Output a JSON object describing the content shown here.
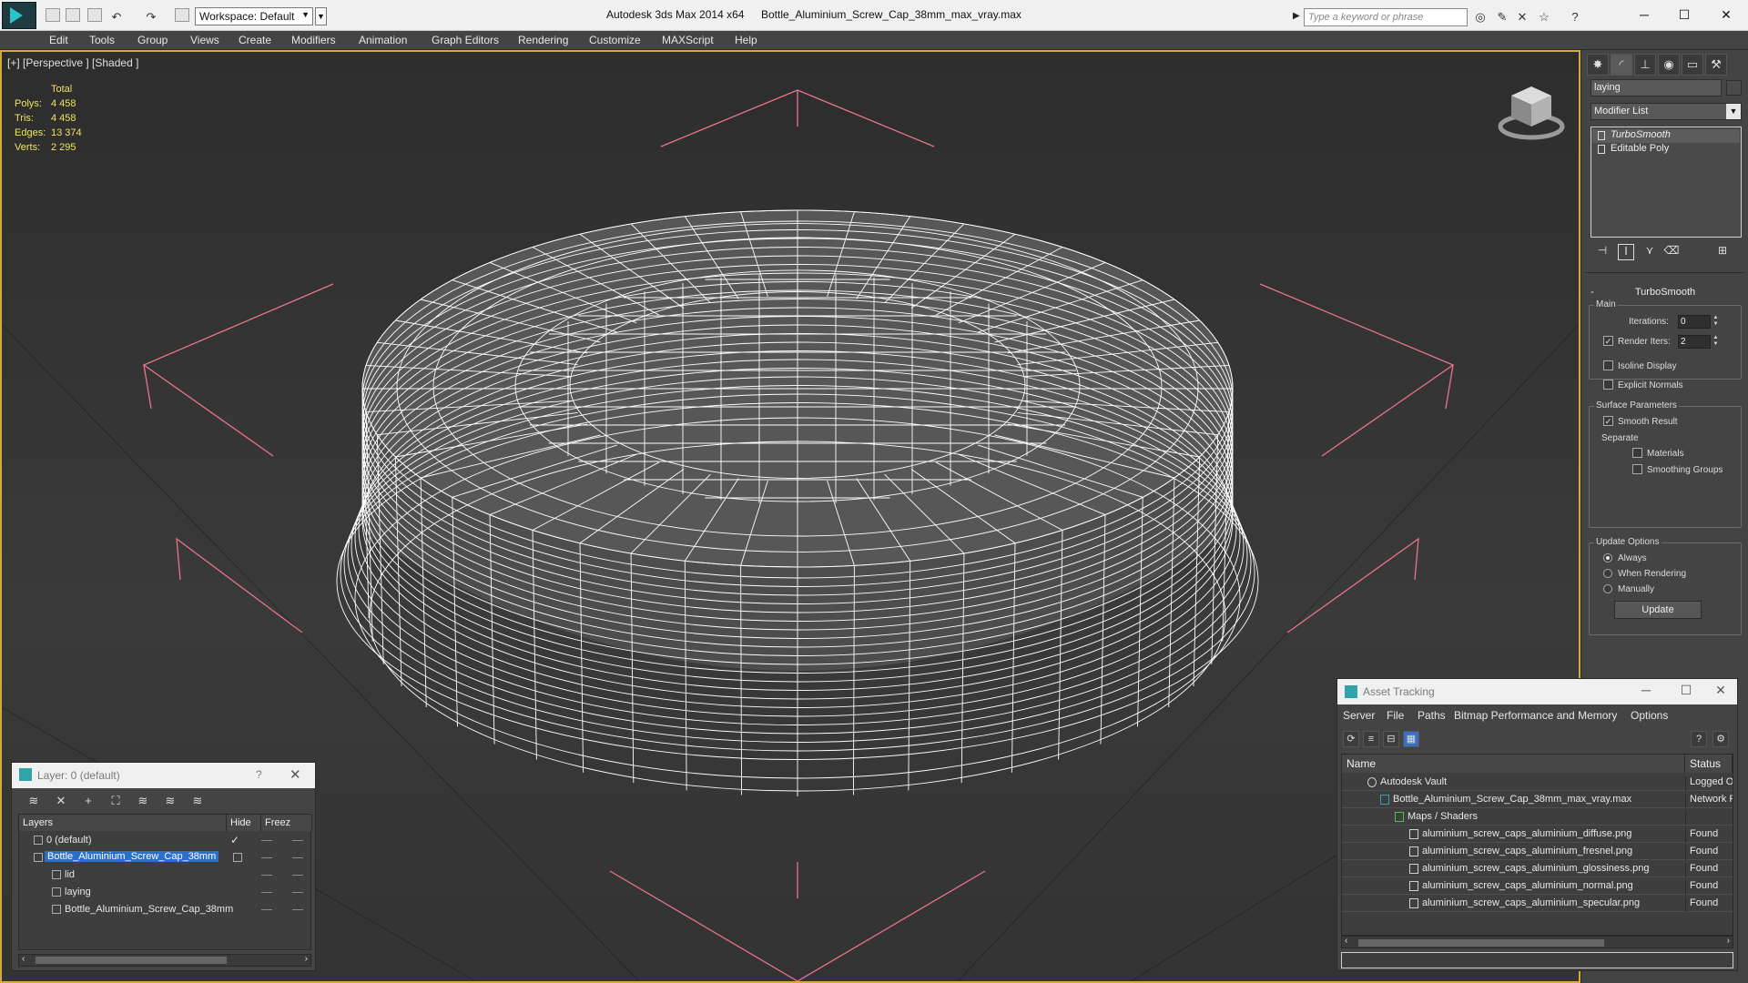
{
  "titlebar": {
    "workspace": "Workspace: Default",
    "app_title": "Autodesk 3ds Max  2014 x64",
    "file_title": "Bottle_Aluminium_Screw_Cap_38mm_max_vray.max",
    "search_placeholder": "Type a keyword or phrase"
  },
  "menu": [
    "Edit",
    "Tools",
    "Group",
    "Views",
    "Create",
    "Modifiers",
    "Animation",
    "Graph Editors",
    "Rendering",
    "Customize",
    "MAXScript",
    "Help"
  ],
  "viewport": {
    "label": "[+] [Perspective ] [Shaded ]",
    "stats_header": "Total",
    "stats": [
      {
        "key": "Polys:",
        "value": "4 458"
      },
      {
        "key": "Tris:",
        "value": "4 458"
      },
      {
        "key": "Edges:",
        "value": "13 374"
      },
      {
        "key": "Verts:",
        "value": "2 295"
      }
    ]
  },
  "command_panel": {
    "object_name": "laying",
    "modifier_list": "Modifier List",
    "stack": [
      {
        "label": "TurboSmooth",
        "selected": true
      },
      {
        "label": "Editable Poly",
        "selected": false
      }
    ],
    "rollout_title": "TurboSmooth",
    "main_label": "Main",
    "iterations_label": "Iterations:",
    "iterations_value": "0",
    "render_iters_label": "Render Iters:",
    "render_iters_value": "2",
    "isoline_label": "Isoline Display",
    "explicit_normals_label": "Explicit Normals",
    "surface_params_label": "Surface Parameters",
    "smooth_result_label": "Smooth Result",
    "separate_label": "Separate",
    "materials_label": "Materials",
    "smoothing_groups_label": "Smoothing Groups",
    "update_options_label": "Update Options",
    "always_label": "Always",
    "when_rendering_label": "When Rendering",
    "manually_label": "Manually",
    "update_button": "Update"
  },
  "layer_dialog": {
    "title": "Layer: 0 (default)",
    "help": "?",
    "col_layers": "Layers",
    "col_hide": "Hide",
    "col_freeze": "Freez",
    "rows": [
      {
        "name": "0 (default)"
      },
      {
        "name": "Bottle_Aluminium_Screw_Cap_38mm"
      },
      {
        "name": "lid"
      },
      {
        "name": "laying"
      },
      {
        "name": "Bottle_Aluminium_Screw_Cap_38mm"
      }
    ]
  },
  "asset_tracking": {
    "title": "Asset Tracking",
    "menu": [
      "Server",
      "File",
      "Paths",
      "Bitmap Performance and Memory",
      "Options"
    ],
    "col_name": "Name",
    "col_status": "Status",
    "rows": [
      {
        "name": "Autodesk Vault",
        "status": "Logged O"
      },
      {
        "name": "Bottle_Aluminium_Screw_Cap_38mm_max_vray.max",
        "status": "Network P"
      },
      {
        "name": "Maps / Shaders",
        "status": ""
      },
      {
        "name": "aluminium_screw_caps_aluminium_diffuse.png",
        "status": "Found"
      },
      {
        "name": "aluminium_screw_caps_aluminium_fresnel.png",
        "status": "Found"
      },
      {
        "name": "aluminium_screw_caps_aluminium_glossiness.png",
        "status": "Found"
      },
      {
        "name": "aluminium_screw_caps_aluminium_normal.png",
        "status": "Found"
      },
      {
        "name": "aluminium_screw_caps_aluminium_specular.png",
        "status": "Found"
      }
    ]
  },
  "colors": {
    "viewport_border": "#d9a83a",
    "stats_text": "#f2e25c",
    "selection_blue": "#2a6fc9",
    "wire": "#ffffff",
    "bbox_pink": "#e8748c"
  }
}
